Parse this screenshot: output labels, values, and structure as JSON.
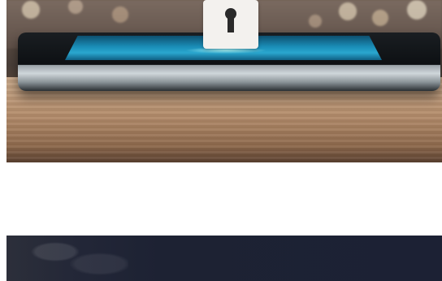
{
  "images": {
    "hero": {
      "icon": "padlock-icon",
      "accent_color": "#2aa7cf"
    },
    "second": {
      "background_color": "#1d2233"
    }
  }
}
